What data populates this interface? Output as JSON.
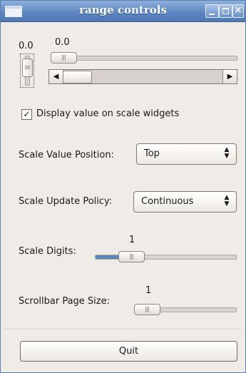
{
  "window": {
    "title": "range controls"
  },
  "vertical_scale": {
    "value_label": "0.0",
    "value": 0.0
  },
  "horizontal_scale": {
    "value_label": "0.0",
    "value": 0.0
  },
  "scrollbar": {
    "left_arrow": "◀",
    "right_arrow": "▶"
  },
  "display_value": {
    "label": "Display value on scale widgets",
    "checked": true,
    "check_mark": "✓"
  },
  "value_position": {
    "label": "Scale Value Position:",
    "selected": "Top"
  },
  "update_policy": {
    "label": "Scale Update Policy:",
    "selected": "Continuous"
  },
  "digits": {
    "label": "Scale Digits:",
    "value_label": "1",
    "value": 1
  },
  "page_size": {
    "label": "Scrollbar Page Size:",
    "value_label": "1",
    "value": 1
  },
  "quit_button": {
    "label": "Quit"
  }
}
